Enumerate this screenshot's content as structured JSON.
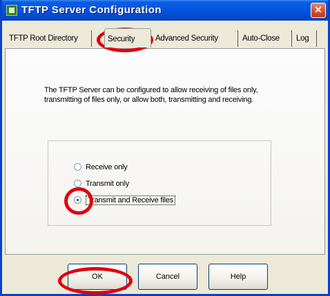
{
  "window": {
    "title": "TFTP Server Configuration",
    "close_glyph": "✕"
  },
  "tabs": [
    {
      "label": "TFTP Root Directory",
      "active": false
    },
    {
      "label": "Security",
      "active": true
    },
    {
      "label": "Advanced Security",
      "active": false
    },
    {
      "label": "Auto-Close",
      "active": false
    },
    {
      "label": "Log",
      "active": false
    }
  ],
  "security": {
    "description": "The TFTP Server can be configured to allow receiving of files only, transmitting of files only, or allow both, transmitting and receiving.",
    "options": [
      {
        "label": "Receive only",
        "checked": false
      },
      {
        "label": "Transmit only",
        "checked": false
      },
      {
        "label": "Transmit and Receive files",
        "checked": true
      }
    ]
  },
  "buttons": {
    "ok": "OK",
    "cancel": "Cancel",
    "help": "Help"
  },
  "annotations": {
    "color": "#e0000e",
    "highlighted": [
      "Security tab",
      "Transmit and Receive files radio",
      "OK button"
    ]
  }
}
